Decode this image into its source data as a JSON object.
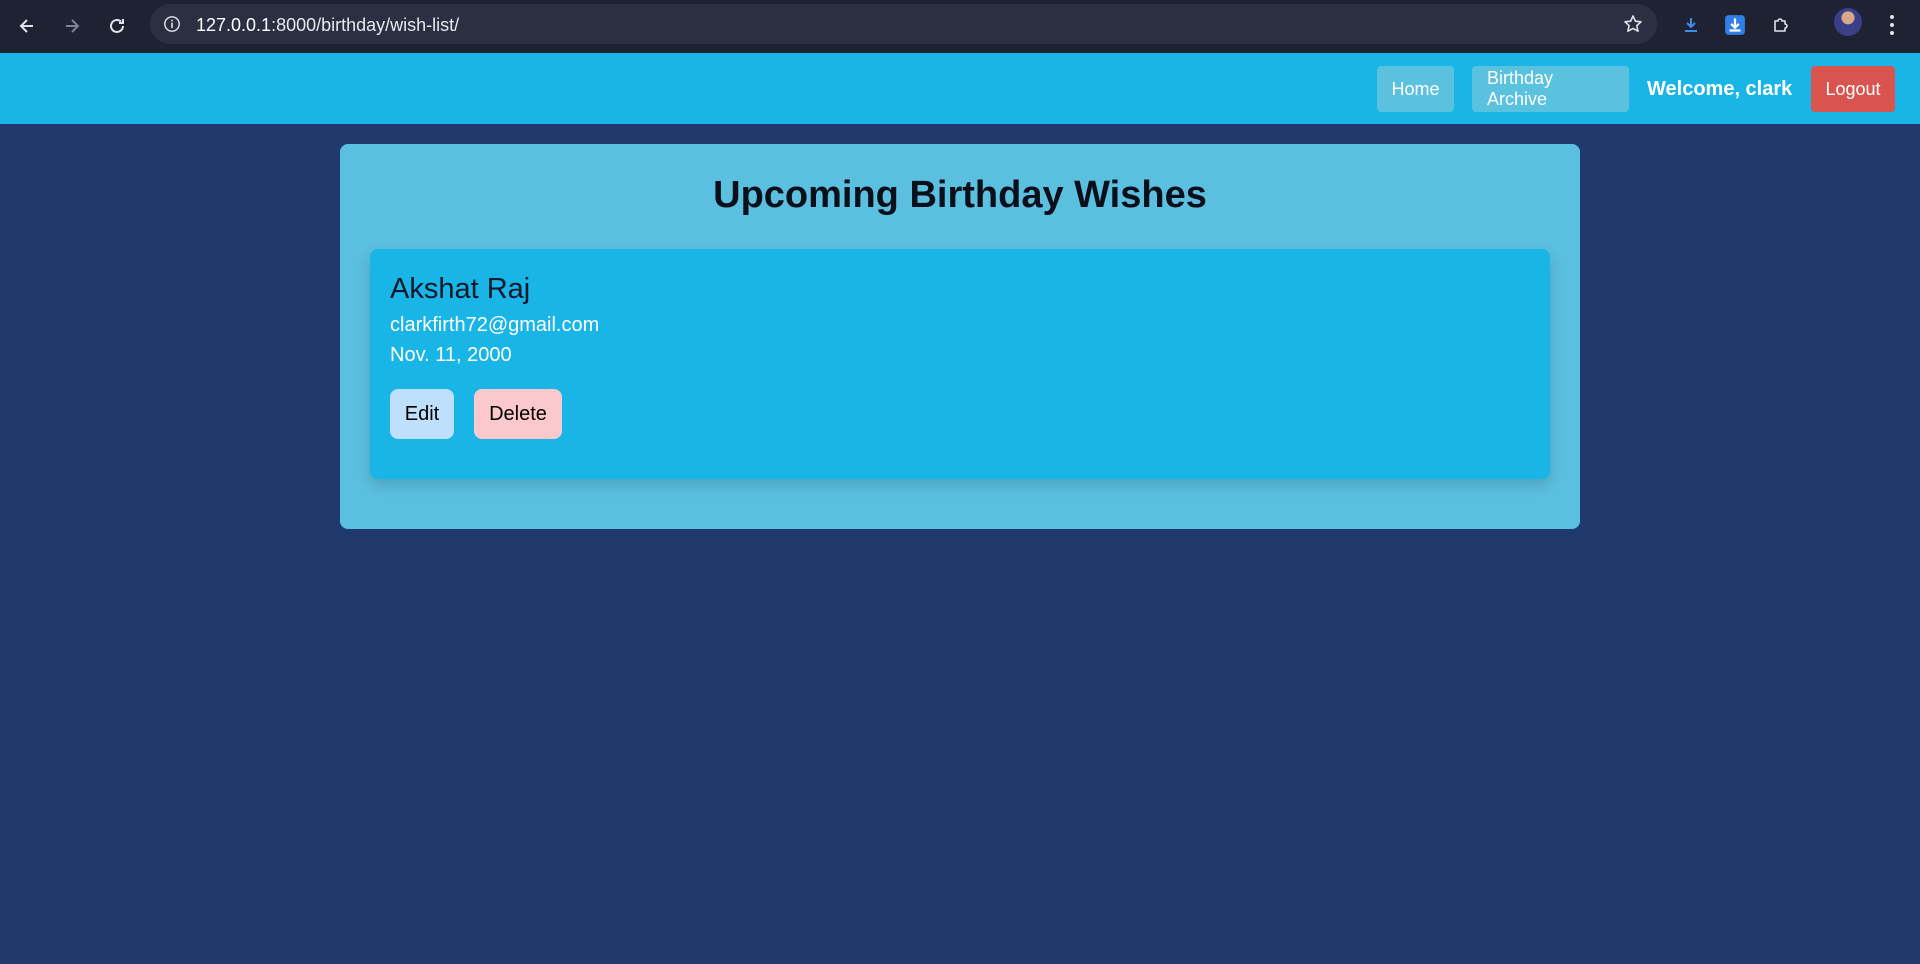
{
  "browser": {
    "url_host": "127.0.0.1",
    "url_path": ":8000/birthday/wish-list/",
    "icons": {
      "back": "back-arrow-icon",
      "forward": "forward-arrow-icon",
      "reload": "reload-icon",
      "info": "info-icon",
      "bookmark": "star-icon",
      "download": "download-icon",
      "download_ext": "download-extension-icon",
      "extensions": "puzzle-icon",
      "profile": "profile-avatar",
      "menu": "more-vert-icon"
    }
  },
  "header": {
    "nav": [
      {
        "label": "Home"
      },
      {
        "label": "Birthday Archive"
      }
    ],
    "welcome": "Welcome, clark",
    "logout_label": "Logout",
    "colors": {
      "background": "#18b5e6",
      "nav_button": "#5ac1df",
      "logout": "#d9534f"
    }
  },
  "main": {
    "title": "Upcoming Birthday Wishes",
    "wishes": [
      {
        "name": "Akshat Raj",
        "email": "clarkfirth72@gmail.com",
        "date": "Nov. 11, 2000",
        "edit_label": "Edit",
        "delete_label": "Delete"
      }
    ],
    "colors": {
      "page_background": "#213a6d",
      "panel": "#5bbfdf",
      "card": "#18b5e6",
      "edit_button": "#bfe0fb",
      "delete_button": "#fbc9cc"
    }
  }
}
